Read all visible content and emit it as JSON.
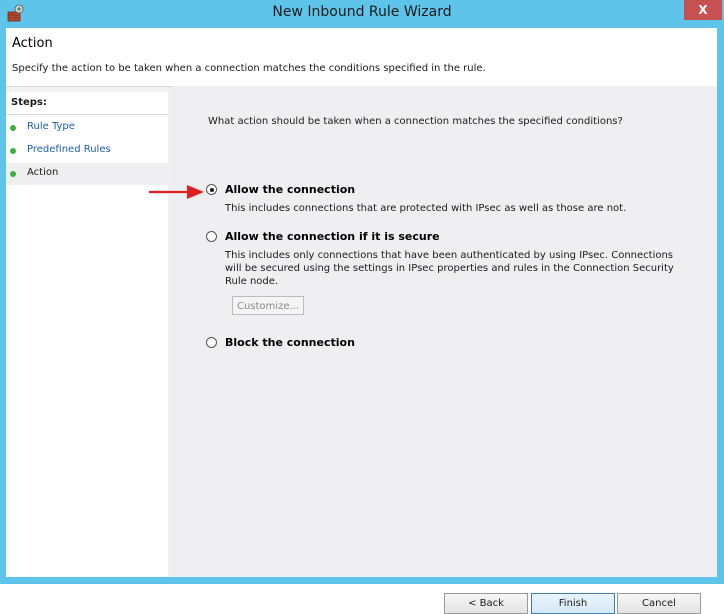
{
  "window": {
    "title": "New Inbound Rule Wizard",
    "close_glyph": "X"
  },
  "header": {
    "title": "Action",
    "description": "Specify the action to be taken when a connection matches the conditions specified in the rule."
  },
  "steps": {
    "label": "Steps:",
    "items": [
      {
        "label": "Rule Type",
        "current": false
      },
      {
        "label": "Predefined Rules",
        "current": false
      },
      {
        "label": "Action",
        "current": true
      }
    ]
  },
  "content": {
    "question": "What action should be taken when a connection matches the specified conditions?",
    "options": [
      {
        "label": "Allow the connection",
        "checked": true,
        "description": "This includes connections that are protected with IPsec as well as those are not."
      },
      {
        "label": "Allow the connection if it is secure",
        "checked": false,
        "description_lines": [
          "This includes only connections that have been authenticated by using IPsec.  Connections",
          "will be secured using the settings in IPsec properties and rules in the Connection Security",
          "Rule node."
        ]
      },
      {
        "label": "Block the connection",
        "checked": false
      }
    ],
    "customize_label": "Customize..."
  },
  "buttons": {
    "back": "< Back",
    "finish": "Finish",
    "cancel": "Cancel"
  },
  "colors": {
    "titlebar": "#5fc4ea",
    "close": "#c75050",
    "step_dot": "#3cb43c",
    "step_link": "#1f5fa8",
    "annotation_arrow": "#e02020"
  },
  "icons": {
    "app": "firewall-wizard-icon",
    "arrow": "red-annotation-arrow"
  }
}
